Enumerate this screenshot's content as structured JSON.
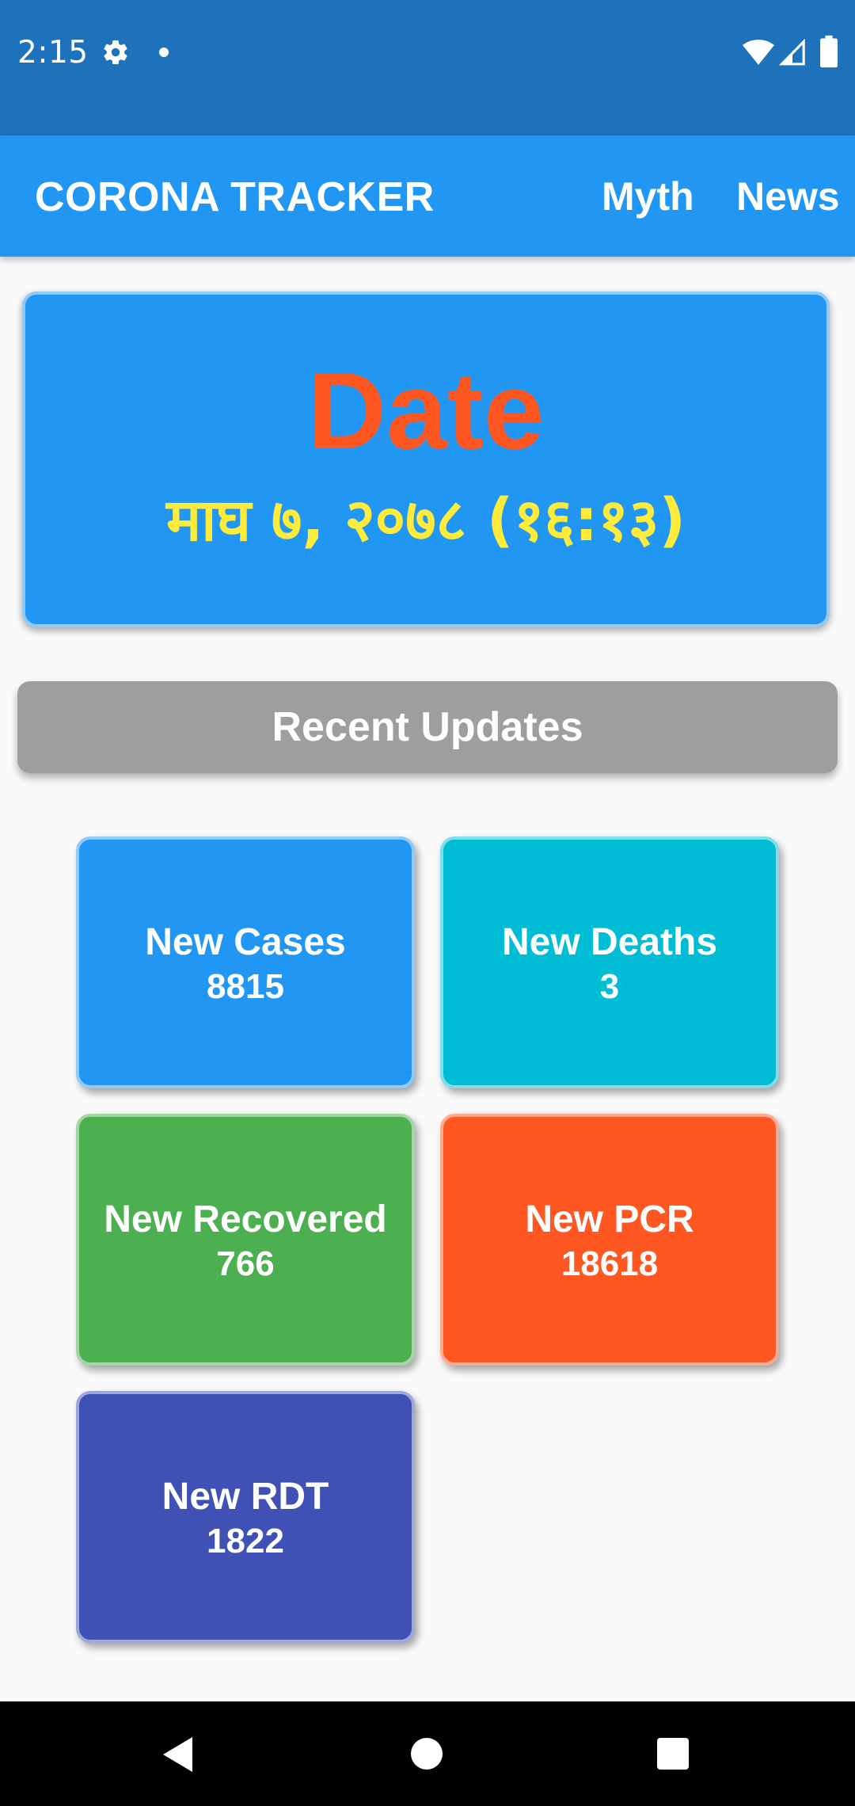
{
  "status_bar": {
    "time": "2:15",
    "icons": [
      "gear-icon",
      "notification-dot-icon",
      "wifi-icon",
      "cell-signal-icon",
      "battery-icon"
    ],
    "background_color": "#1e72bb"
  },
  "app_bar": {
    "title": "CORONA TRACKER",
    "actions": [
      "Myth",
      "News"
    ],
    "background_color": "#2196f3"
  },
  "date_card": {
    "title": "Date",
    "value": "माघ ७, २०७८ (१६:१३)",
    "title_color": "#ff5722",
    "value_color": "#ffeb3b"
  },
  "recent_updates": {
    "label": "Recent Updates"
  },
  "tiles": [
    {
      "label": "New Cases",
      "value": "8815",
      "color": "#2196f3"
    },
    {
      "label": "New Deaths",
      "value": "3",
      "color": "#00bcd4"
    },
    {
      "label": "New Recovered",
      "value": "766",
      "color": "#4caf50"
    },
    {
      "label": "New PCR",
      "value": "18618",
      "color": "#ff5722"
    },
    {
      "label": "New RDT",
      "value": "1822",
      "color": "#3f51b5"
    }
  ],
  "nav_bar": {
    "icons": [
      "back-icon",
      "home-icon",
      "recents-icon"
    ]
  }
}
